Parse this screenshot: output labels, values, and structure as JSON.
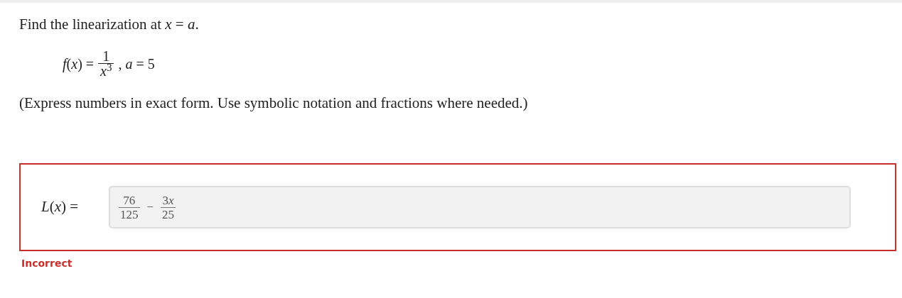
{
  "prompt": "Find the linearization at *x* = *a*.",
  "function": {
    "lhs": "*f*(*x*) =",
    "numerator": "1",
    "denominator": "*x*$^{3}$",
    "rest": ", *a* = 5"
  },
  "instructions": "(Express numbers in exact form. Use symbolic notation and fractions where needed.)",
  "answer": {
    "label": "*L*(*x*) =",
    "terms": [
      {
        "kind": "fraction",
        "numerator": "76",
        "denominator": "125"
      },
      {
        "kind": "operator",
        "text": "−"
      },
      {
        "kind": "fraction",
        "coefficient": "3",
        "variable": "x",
        "denominator": "25"
      }
    ]
  },
  "feedback": {
    "kind": "incorrect",
    "text": "Incorrect"
  }
}
